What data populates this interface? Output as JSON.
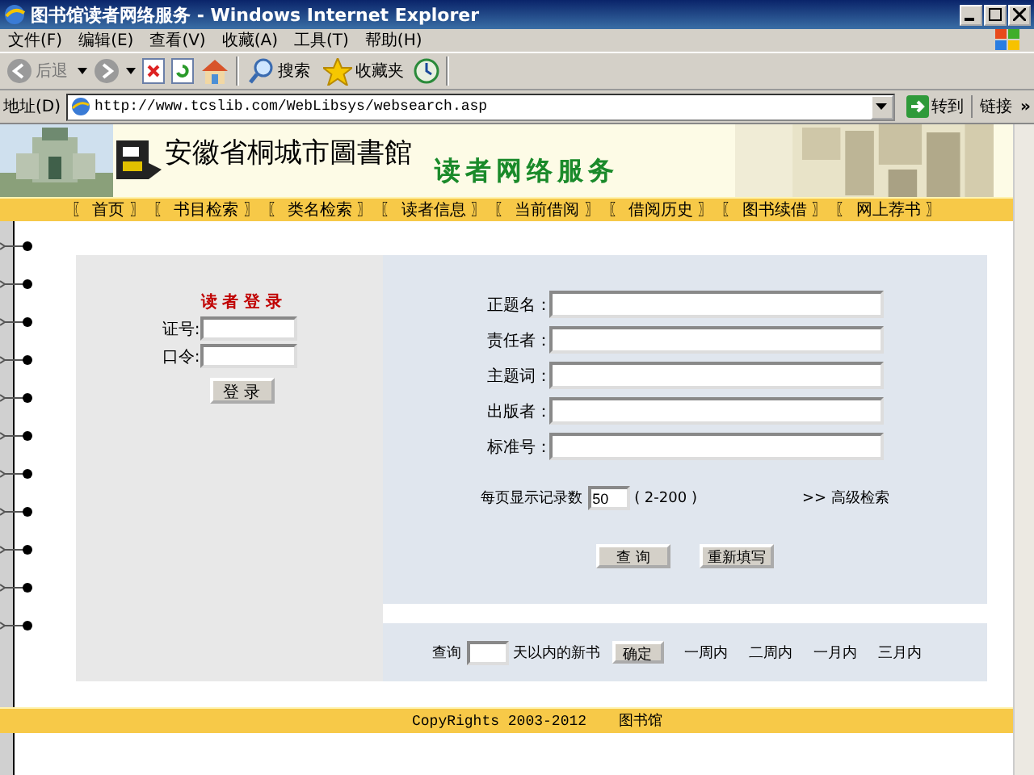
{
  "window": {
    "title": "图书馆读者网络服务 - Windows Internet Explorer"
  },
  "menu": [
    "文件(F)",
    "编辑(E)",
    "查看(V)",
    "收藏(A)",
    "工具(T)",
    "帮助(H)"
  ],
  "toolbar": {
    "back": "后退",
    "search": "搜索",
    "favorites": "收藏夹"
  },
  "address": {
    "label": "地址(D)",
    "url": "http://www.tcslib.com/WebLibsys/websearch.asp",
    "go": "转到",
    "links": "链接",
    "more": "»"
  },
  "header": {
    "library": "安徽省桐城市圖書館",
    "service": "读者网络服务"
  },
  "nav": [
    {
      "label": "〖 首页 〗"
    },
    {
      "label": "〖 书目检索 〗"
    },
    {
      "label": "〖 类名检索 〗"
    },
    {
      "label": "〖 读者信息 〗"
    },
    {
      "label": "〖 当前借阅 〗"
    },
    {
      "label": "〖 借阅历史 〗"
    },
    {
      "label": "〖 图书续借 〗"
    },
    {
      "label": "〖 网上荐书 〗"
    }
  ],
  "login": {
    "title": "读 者 登 录",
    "fields": [
      {
        "label": "证号:"
      },
      {
        "label": "口令:"
      }
    ],
    "button": "登 录"
  },
  "search": {
    "fields": [
      {
        "label": "正题名："
      },
      {
        "label": "责任者："
      },
      {
        "label": "主题词："
      },
      {
        "label": "出版者："
      },
      {
        "label": "标准号："
      }
    ],
    "page_size_label": "每页显示记录数",
    "page_size": "50",
    "range": "( 2-200 )",
    "advanced": ">> 高级检索",
    "buttons": [
      "查 询",
      "重新填写"
    ]
  },
  "new_books": {
    "prefix": "查询",
    "suffix": "天以内的新书",
    "button": "确定",
    "periods": [
      "一周内",
      "二周内",
      "一月内",
      "三月内"
    ]
  },
  "footer": {
    "copyright": "CopyRights 2003-2012",
    "owner": "图书馆"
  }
}
